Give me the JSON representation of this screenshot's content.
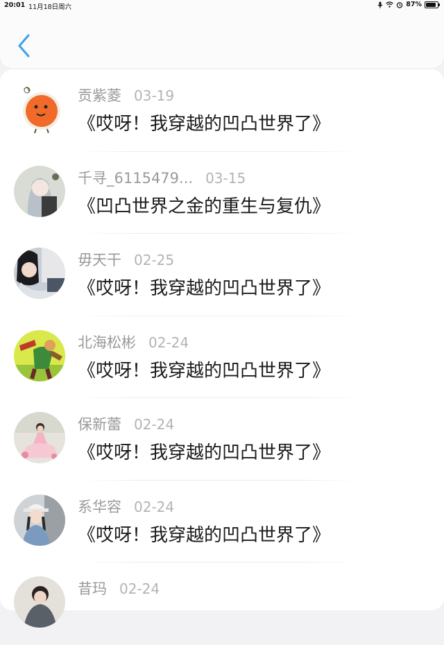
{
  "status_bar": {
    "time": "20:01",
    "date": "11月18日周六",
    "battery": "87%",
    "battery_level": 0.87
  },
  "nav": {
    "back_icon": "chevron-left-icon",
    "accent": "#3aa0f0"
  },
  "items": [
    {
      "name": "贡紫菱",
      "date": "03-19",
      "book": "《哎呀！我穿越的凹凸世界了》",
      "avatar": "orange-fruit"
    },
    {
      "name": "千寻_6115479...",
      "date": "03-15",
      "book": "《凹凸世界之金的重生与复仇》",
      "avatar": "anime-girl"
    },
    {
      "name": "毋天干",
      "date": "02-25",
      "book": "《哎呀！我穿越的凹凸世界了》",
      "avatar": "girl-photo"
    },
    {
      "name": "北海松彬",
      "date": "02-24",
      "book": "《哎呀！我穿越的凹凸世界了》",
      "avatar": "cartoon-green"
    },
    {
      "name": "保新蕾",
      "date": "02-24",
      "book": "《哎呀！我穿越的凹凸世界了》",
      "avatar": "girl-pink-dress"
    },
    {
      "name": "系华容",
      "date": "02-24",
      "book": "《哎呀！我穿越的凹凸世界了》",
      "avatar": "girl-cap"
    },
    {
      "name": "昔玛",
      "date": "02-24",
      "book": "",
      "avatar": "girl-partial"
    }
  ]
}
